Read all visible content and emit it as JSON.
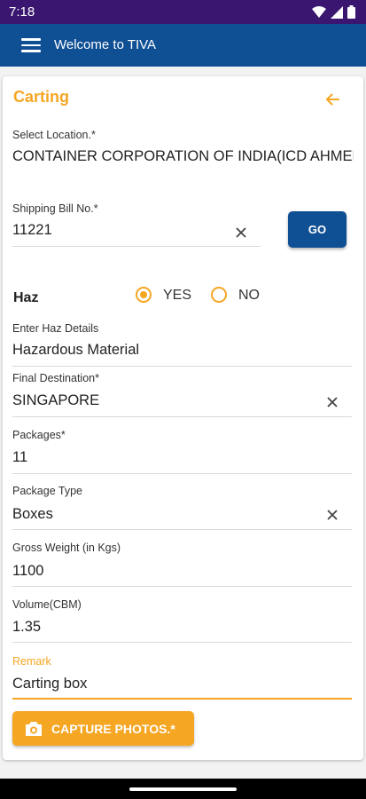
{
  "status_bar": {
    "time": "7:18",
    "icons": [
      "wifi-icon",
      "signal-icon",
      "battery-icon"
    ]
  },
  "app_bar": {
    "title": "Welcome to TIVA",
    "menu_icon": "hamburger-menu-icon"
  },
  "form": {
    "title": "Carting",
    "back_icon": "arrow-left-icon",
    "location": {
      "label": "Select Location.*",
      "value": "CONTAINER CORPORATION OF INDIA(ICD AHMEDABAD)"
    },
    "shipping_bill": {
      "label": "Shipping Bill No.*",
      "value": "11221",
      "go_label": "GO"
    },
    "haz": {
      "label": "Haz",
      "options": [
        "YES",
        "NO"
      ],
      "selected": "YES"
    },
    "haz_details": {
      "label": "Enter Haz Details",
      "value": "Hazardous Material"
    },
    "final_destination": {
      "label": "Final Destination*",
      "value": "SINGAPORE"
    },
    "packages": {
      "label": "Packages*",
      "value": "11"
    },
    "package_type": {
      "label": "Package Type",
      "value": "Boxes"
    },
    "gross_weight": {
      "label": "Gross Weight (in Kgs)",
      "value": "1100"
    },
    "volume": {
      "label": "Volume(CBM)",
      "value": "1.35"
    },
    "remark": {
      "label": "Remark",
      "value": "Carting box"
    },
    "capture_button": {
      "label": "CAPTURE PHOTOS.*",
      "icon": "camera-icon"
    }
  },
  "colors": {
    "accent": "#f5a623",
    "primary": "#0f4f94",
    "status_bar": "#3a1670"
  }
}
